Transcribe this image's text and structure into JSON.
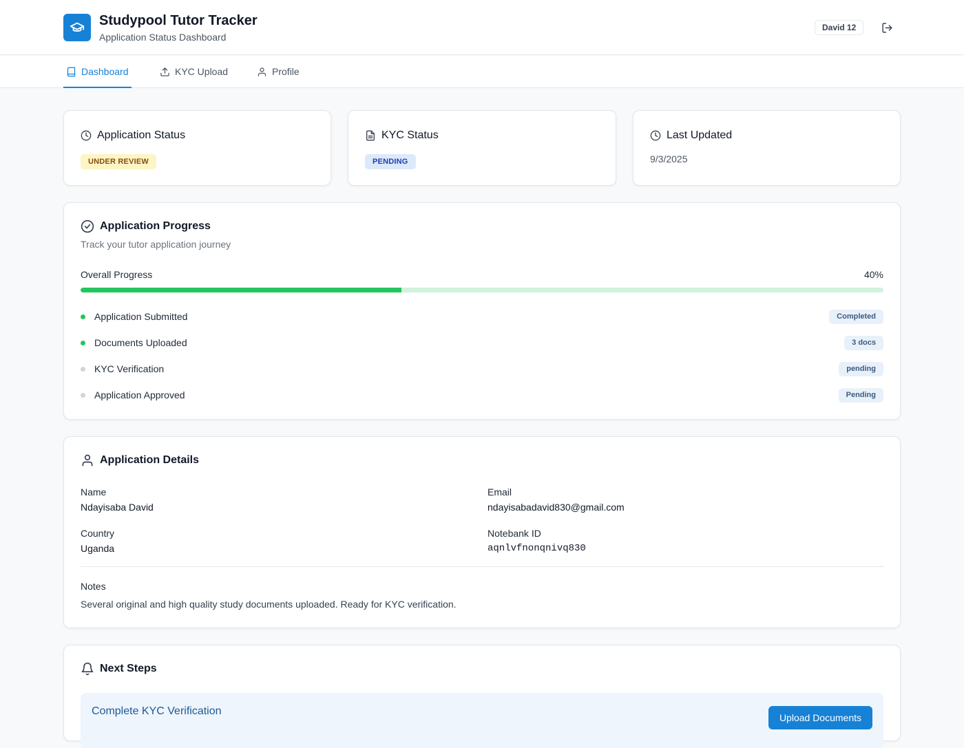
{
  "header": {
    "title": "Studypool Tutor Tracker",
    "subtitle": "Application Status Dashboard",
    "user_badge": "David 12",
    "logo_icon": "graduation-cap-icon",
    "logout_icon": "logout-icon"
  },
  "tabs": [
    {
      "label": "Dashboard",
      "icon": "book-icon",
      "active": true
    },
    {
      "label": "KYC Upload",
      "icon": "upload-icon",
      "active": false
    },
    {
      "label": "Profile",
      "icon": "user-icon",
      "active": false
    }
  ],
  "status_cards": {
    "application": {
      "title": "Application Status",
      "badge": "UNDER REVIEW",
      "badge_bg": "#fdf5c4",
      "badge_color": "#854d0e"
    },
    "kyc": {
      "title": "KYC Status",
      "badge": "PENDING",
      "badge_bg": "#dbe9fb",
      "badge_color": "#1e40af"
    },
    "last_updated": {
      "title": "Last Updated",
      "value": "9/3/2025"
    }
  },
  "progress": {
    "title": "Application Progress",
    "subtitle": "Track your tutor application journey",
    "overall_label": "Overall Progress",
    "percent_label": "40%",
    "percent": 40,
    "fill_color": "#22c55e",
    "track_color": "#d1f2dc",
    "steps": [
      {
        "label": "Application Submitted",
        "status": "Completed",
        "done": true
      },
      {
        "label": "Documents Uploaded",
        "status": "3 docs",
        "done": true
      },
      {
        "label": "KYC Verification",
        "status": "pending",
        "done": false
      },
      {
        "label": "Application Approved",
        "status": "Pending",
        "done": false
      }
    ]
  },
  "details": {
    "title": "Application Details",
    "name_label": "Name",
    "name": "Ndayisaba David",
    "email_label": "Email",
    "email": "ndayisabadavid830@gmail.com",
    "country_label": "Country",
    "country": "Uganda",
    "notebank_label": "Notebank ID",
    "notebank_id": "aqnlvfnonqnivq830",
    "notes_label": "Notes",
    "notes": "Several original and high quality study documents uploaded. Ready for KYC verification."
  },
  "next_steps": {
    "title": "Next Steps",
    "item_title": "Complete KYC Verification",
    "button_label": "Upload Documents"
  },
  "colors": {
    "accent": "#1781d6",
    "done_dot": "#22c55e",
    "pending_dot": "#d1d5db"
  }
}
